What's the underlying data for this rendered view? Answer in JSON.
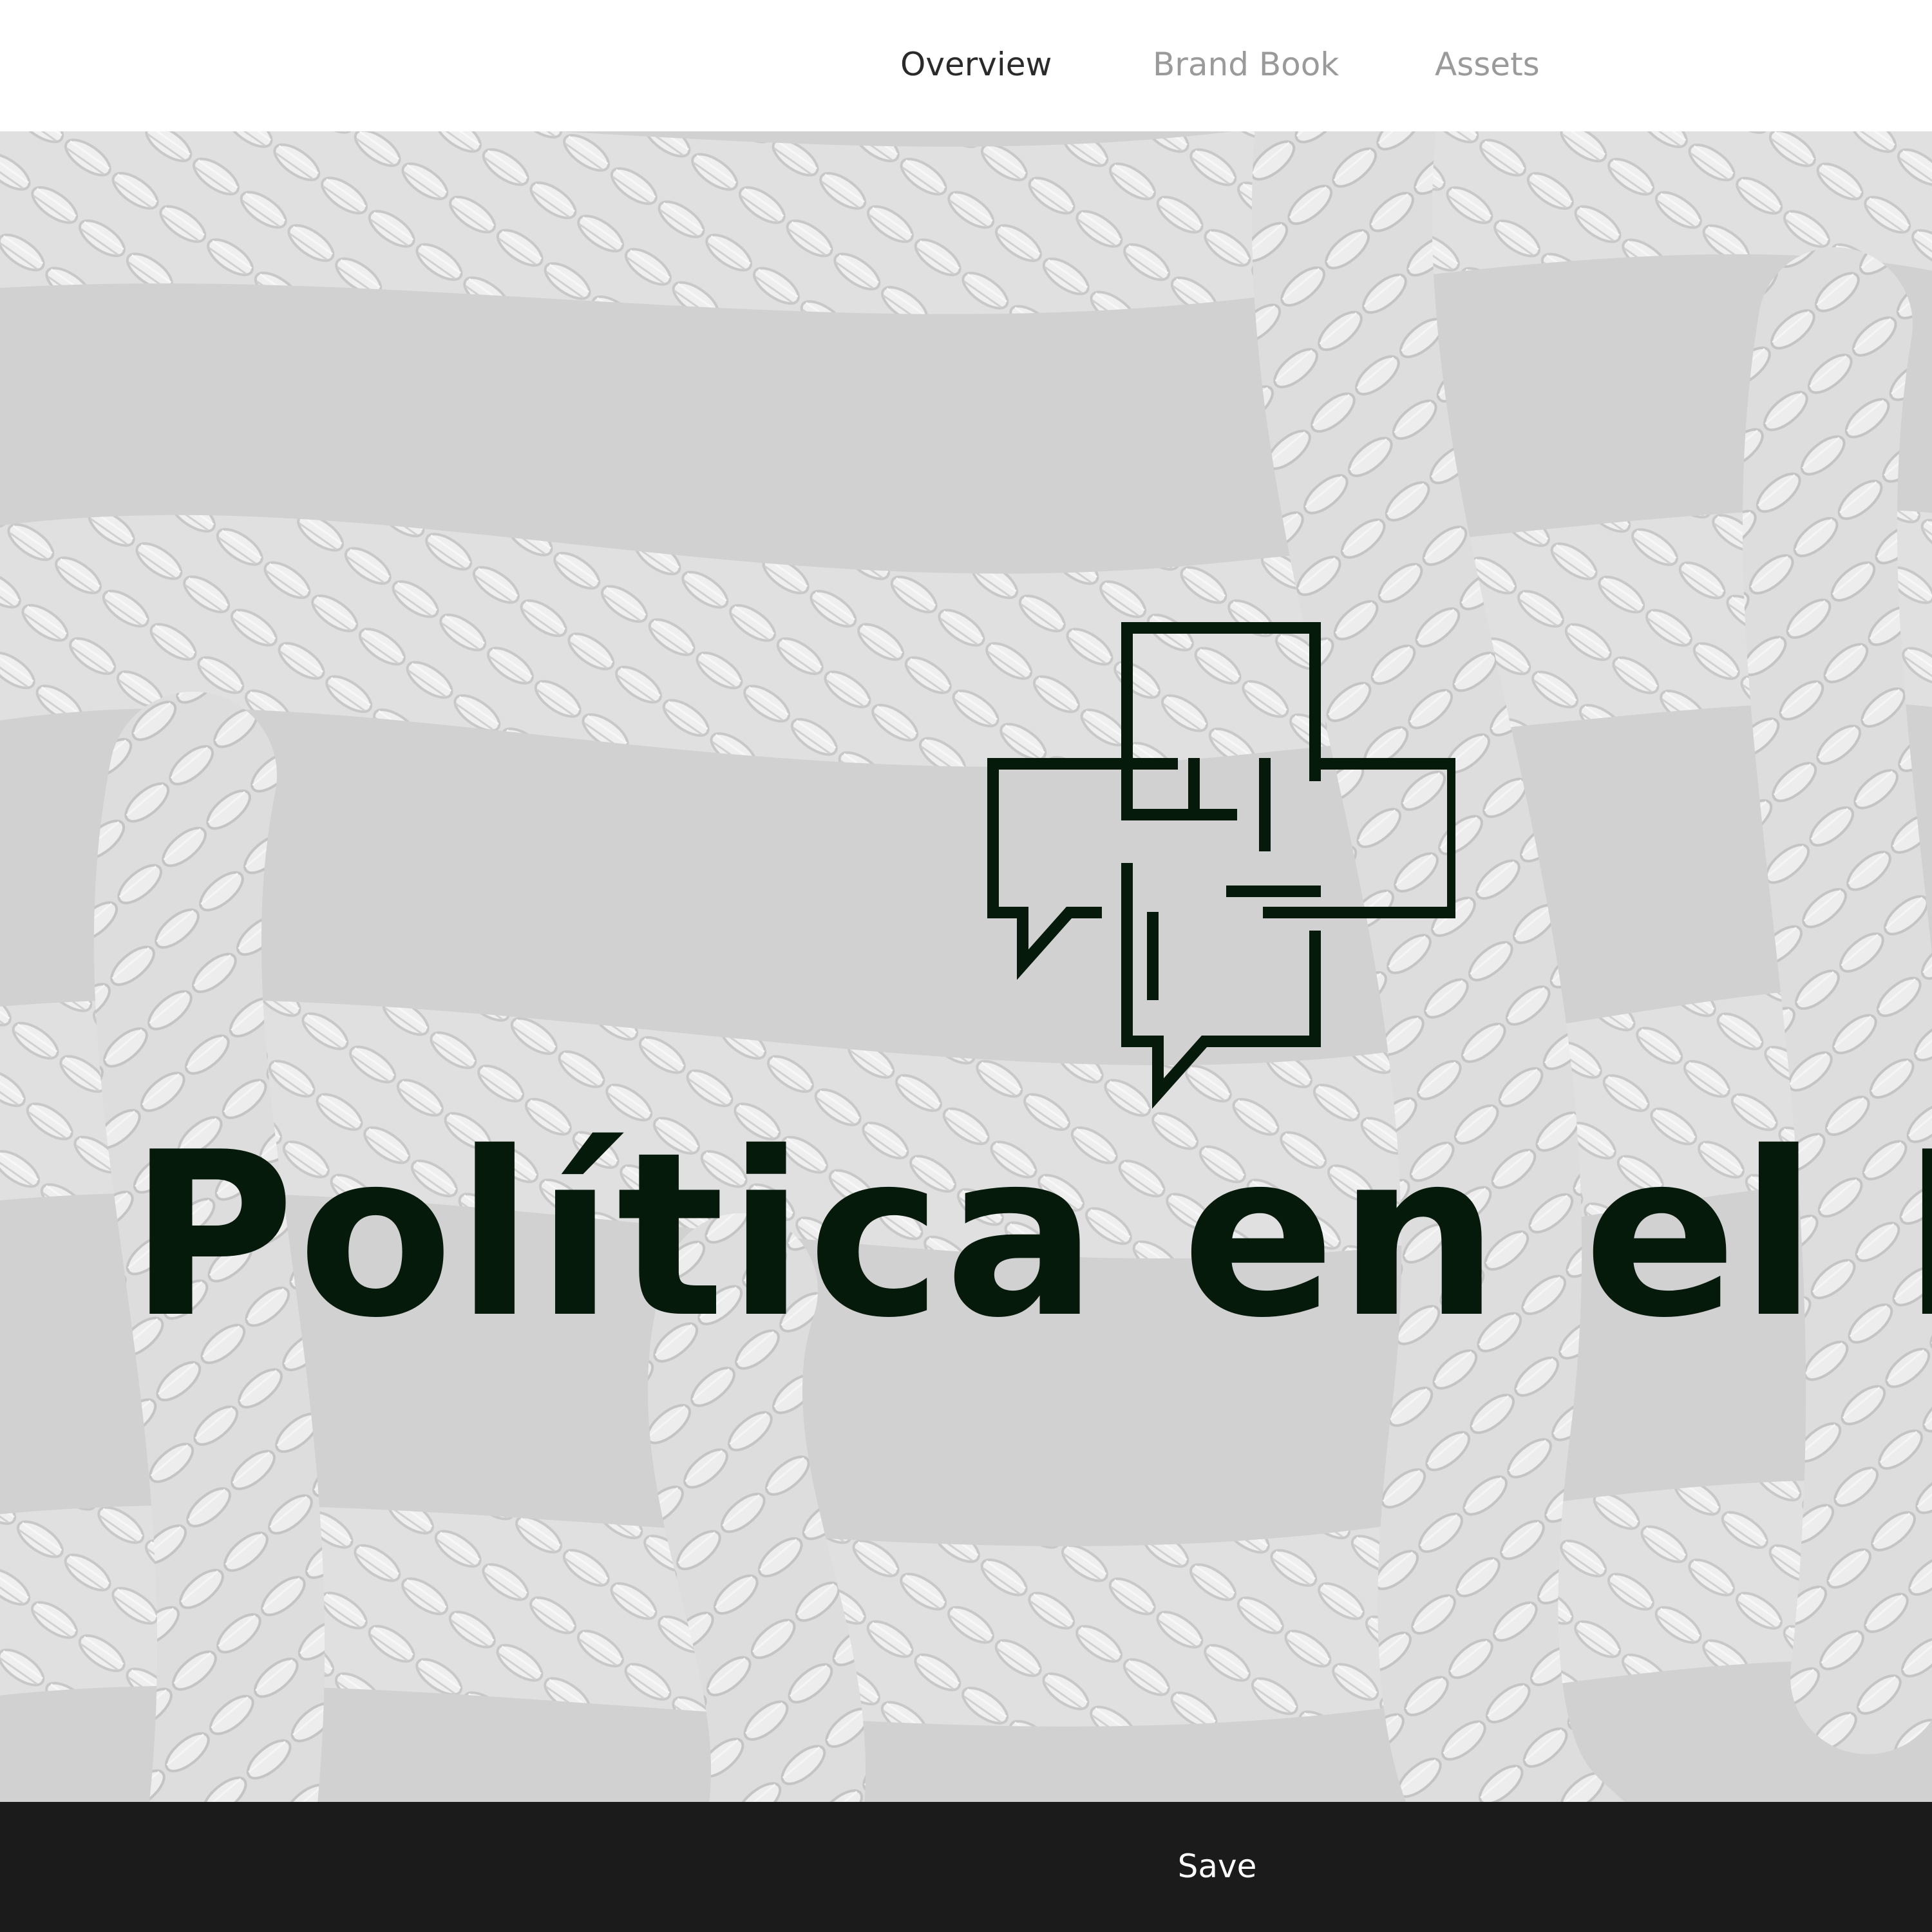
{
  "nav": {
    "tabs": [
      {
        "label": "Overview",
        "active": true
      },
      {
        "label": "Brand Book",
        "active": false
      },
      {
        "label": "Assets",
        "active": false
      }
    ]
  },
  "hero": {
    "background": "rope-texture-image",
    "logo_icon": "speech-bubbles-icon",
    "brand_name": "Política en el Bar",
    "brand_color": "#061a0c"
  },
  "footer": {
    "save_label": "Save",
    "bar_color": "#1b1b1b"
  }
}
